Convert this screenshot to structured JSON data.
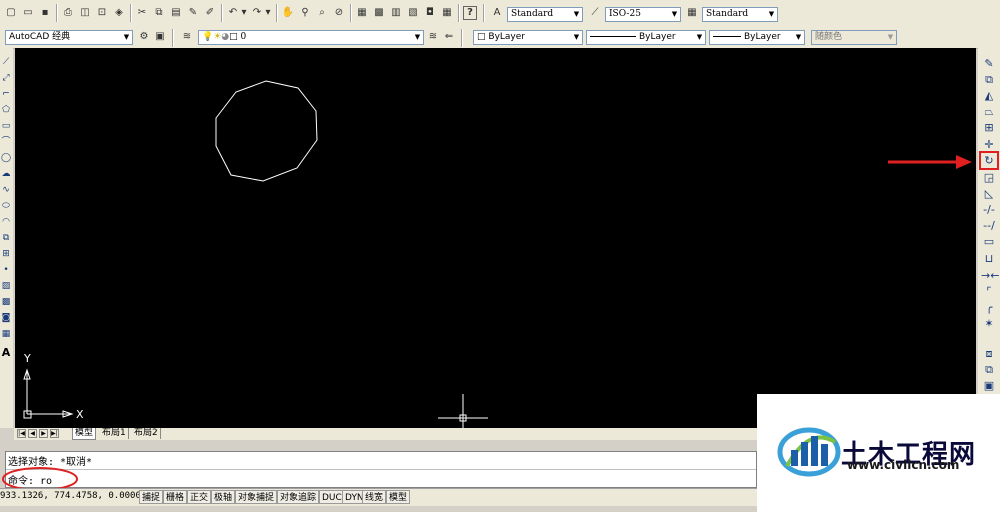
{
  "toolbar_top": {
    "text_style": "Standard",
    "dim_style": "ISO-25",
    "table_style": "Standard"
  },
  "toolbar_second": {
    "workspace": "AutoCAD 经典",
    "layer": "0",
    "color": "ByLayer",
    "linetype": "ByLayer",
    "lineweight": "ByLayer",
    "plot_style": "随颜色"
  },
  "canvas": {
    "background": "#000000",
    "ucs_x_label": "X",
    "ucs_y_label": "Y"
  },
  "layout_tabs": [
    "模型",
    "布局1",
    "布局2"
  ],
  "command": {
    "line1": "选择对象: *取消*",
    "line2": "命令: ro"
  },
  "status_bar": {
    "coordinates": "933.1326,  774.4758, 0.0000",
    "toggles": [
      "捕捉",
      "栅格",
      "正交",
      "极轴",
      "对象捕捉",
      "对象追踪",
      "DUCS",
      "DYN",
      "线宽",
      "模型"
    ]
  },
  "annotations": {
    "highlight_color": "#e02020"
  },
  "watermark": {
    "title": "土木工程网",
    "url": "www.civilcn.com"
  }
}
